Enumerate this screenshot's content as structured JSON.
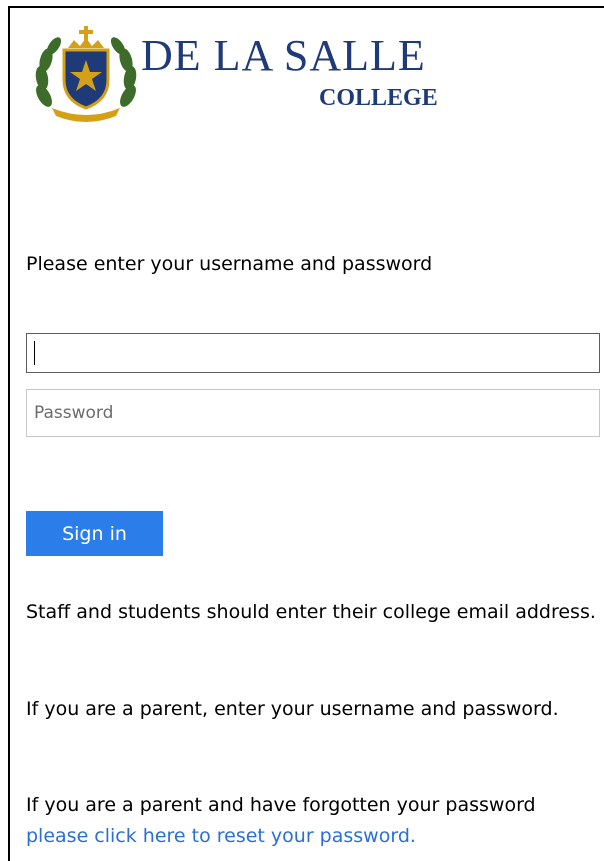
{
  "logo": {
    "name": "DE LA SALLE",
    "sub": "COLLEGE",
    "crest_icon": "college-crest",
    "brand_color": "#1f3a78",
    "crest_gold": "#d4a017",
    "crest_green": "#3c6b2a"
  },
  "form": {
    "instruction": "Please enter your username and password",
    "username_value": "",
    "password_placeholder": "Password",
    "signin_label": "Sign in",
    "button_color": "#2b7de9"
  },
  "help": {
    "staff_text": "Staff and students should enter their college email address.",
    "parent_text": "If you are a parent, enter your username and password.",
    "forgot_text": "If you are a parent and have forgotten your password",
    "reset_link": "please click here to reset your password.",
    "link_color": "#2b6fd6"
  }
}
